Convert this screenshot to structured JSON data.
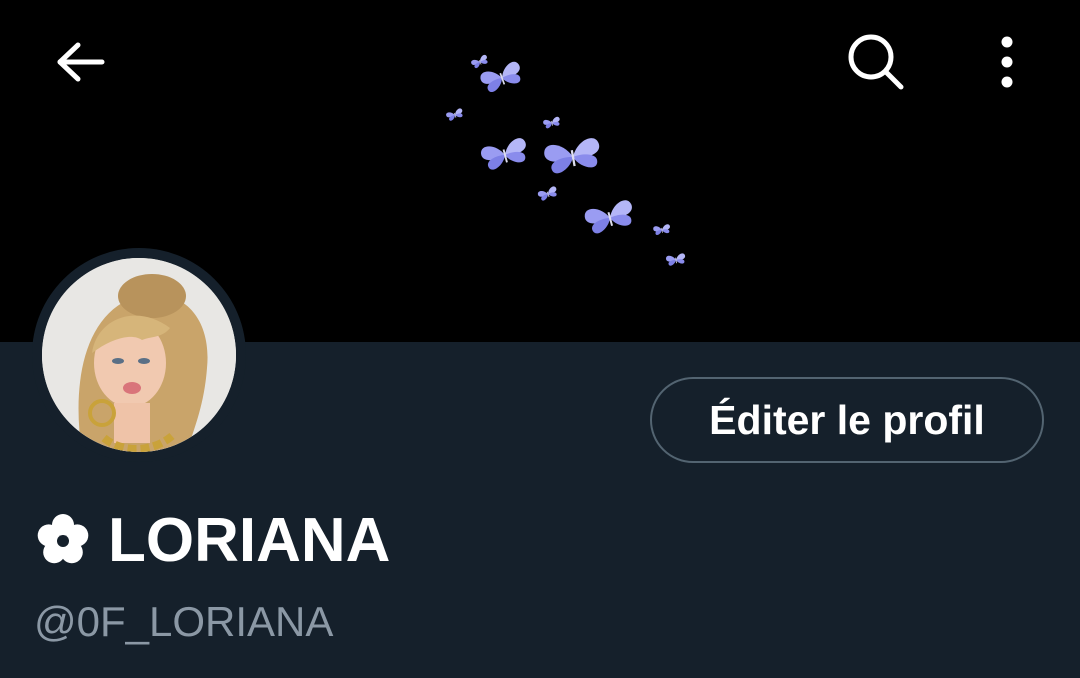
{
  "header": {
    "back_icon": "arrow-left-icon",
    "search_icon": "search-icon",
    "more_icon": "more-vertical-icon"
  },
  "banner": {
    "description_icon": "butterflies-icon",
    "background_color": "#000000",
    "accent_color": "#8f8ff0"
  },
  "profile": {
    "edit_button_label": "Éditer le profil",
    "display_name": "LORIANA",
    "display_name_prefix_icon": "flower-icon",
    "handle": "@0F_LORIANA"
  },
  "colors": {
    "background": "#15202b",
    "text_primary": "#ffffff",
    "text_secondary": "#8b98a5",
    "border": "#536471"
  }
}
